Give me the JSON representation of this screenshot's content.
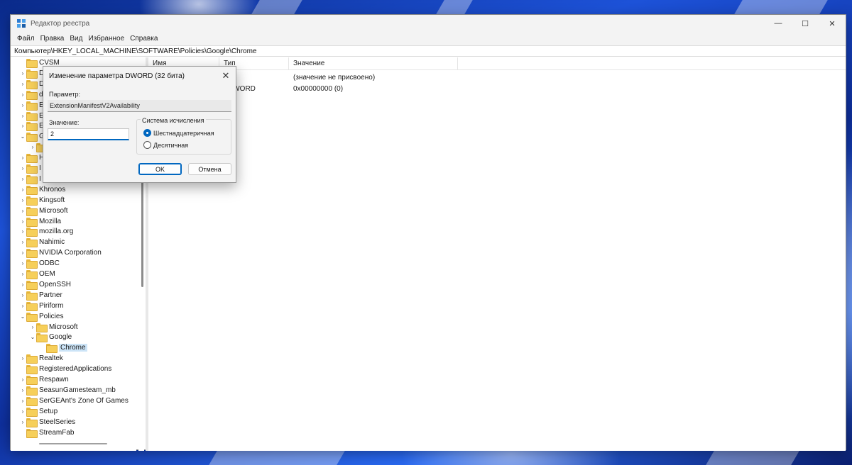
{
  "window": {
    "title": "Редактор реестра",
    "controls": {
      "minimize": "—",
      "maximize": "☐",
      "close": "✕"
    }
  },
  "menu": [
    "Файл",
    "Правка",
    "Вид",
    "Избранное",
    "Справка"
  ],
  "address": "Компьютер\\HKEY_LOCAL_MACHINE\\SOFTWARE\\Policies\\Google\\Chrome",
  "tree": {
    "partial_items": [
      "CVSM",
      "D",
      "D",
      "d",
      "E",
      "E",
      "E",
      "G",
      "",
      "H",
      "I",
      "I"
    ],
    "items": [
      {
        "label": "Khronos",
        "chevron": "›",
        "indent": 0
      },
      {
        "label": "Kingsoft",
        "chevron": "›",
        "indent": 0
      },
      {
        "label": "Microsoft",
        "chevron": "›",
        "indent": 0
      },
      {
        "label": "Mozilla",
        "chevron": "›",
        "indent": 0
      },
      {
        "label": "mozilla.org",
        "chevron": "›",
        "indent": 0
      },
      {
        "label": "Nahimic",
        "chevron": "›",
        "indent": 0
      },
      {
        "label": "NVIDIA Corporation",
        "chevron": "›",
        "indent": 0
      },
      {
        "label": "ODBC",
        "chevron": "›",
        "indent": 0
      },
      {
        "label": "OEM",
        "chevron": "›",
        "indent": 0
      },
      {
        "label": "OpenSSH",
        "chevron": "›",
        "indent": 0
      },
      {
        "label": "Partner",
        "chevron": "›",
        "indent": 0
      },
      {
        "label": "Piriform",
        "chevron": "›",
        "indent": 0
      },
      {
        "label": "Policies",
        "chevron": "⌄",
        "indent": 0
      },
      {
        "label": "Microsoft",
        "chevron": "›",
        "indent": 1
      },
      {
        "label": "Google",
        "chevron": "⌄",
        "indent": 1
      },
      {
        "label": "Chrome",
        "chevron": "",
        "indent": 2,
        "selected": true
      },
      {
        "label": "Realtek",
        "chevron": "›",
        "indent": 0
      },
      {
        "label": "RegisteredApplications",
        "chevron": "",
        "indent": 0
      },
      {
        "label": "Respawn",
        "chevron": "›",
        "indent": 0
      },
      {
        "label": "SeasunGamesteam_mb",
        "chevron": "›",
        "indent": 0
      },
      {
        "label": "SerGEAnt's Zone Of Games",
        "chevron": "›",
        "indent": 0
      },
      {
        "label": "Setup",
        "chevron": "›",
        "indent": 0
      },
      {
        "label": "SteelSeries",
        "chevron": "›",
        "indent": 0
      },
      {
        "label": "StreamFab",
        "chevron": "",
        "indent": 0
      }
    ]
  },
  "list": {
    "columns": [
      "Имя",
      "Тип",
      "Значение"
    ],
    "rows": [
      {
        "name": "",
        "type": "Z",
        "value": "(значение не присвоено)"
      },
      {
        "name": "",
        "type": "DWORD",
        "value": "0x00000000 (0)"
      }
    ]
  },
  "dialog": {
    "title": "Изменение параметра DWORD (32 бита)",
    "close": "✕",
    "param_label": "Параметр:",
    "param_value": "ExtensionManifestV2Availability",
    "value_label": "Значение:",
    "value": "2",
    "radix_label": "Система исчисления",
    "radix_options": [
      {
        "label": "Шестнадцатеричная",
        "checked": true
      },
      {
        "label": "Десятичная",
        "checked": false
      }
    ],
    "ok": "OK",
    "cancel": "Отмена"
  },
  "colors": {
    "accent": "#0067c0",
    "selection": "#cce4f7",
    "folder": "#f6cf5a"
  }
}
